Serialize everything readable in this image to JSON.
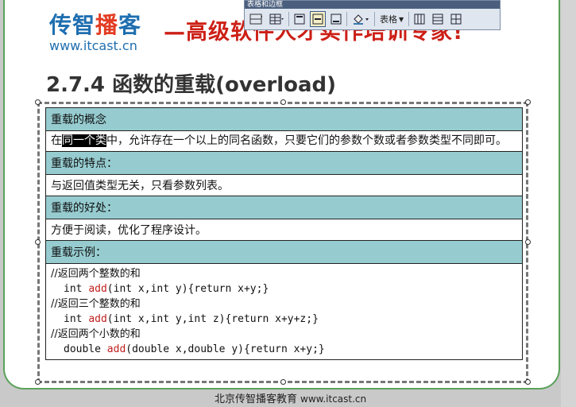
{
  "header": {
    "logo_part1": "传智",
    "logo_part2": "播",
    "logo_part3": "客",
    "logo_url": "www.itcast.cn",
    "slogan": "—高级软件人才实作培训专家!"
  },
  "toolbar": {
    "title": "表格和边框",
    "table_menu": "表格"
  },
  "slide": {
    "title": "2.7.4 函数的重载(overload)",
    "sections": [
      {
        "header": "重载的概念",
        "text_before": "在",
        "selected": "同一个类",
        "text_after": "中，允许存在一个以上的同名函数，只要它们的参数个数或者参数类型不同即可。"
      },
      {
        "header": "重载的特点：",
        "text": "与返回值类型无关，只看参数列表。"
      },
      {
        "header": "重载的好处：",
        "text": "方便于阅读，优化了程序设计。"
      },
      {
        "header": "重载示例："
      }
    ],
    "code": [
      {
        "comment": "//返回两个整数的和"
      },
      {
        "pre": "int ",
        "fn": "add",
        "post": "(int x,int y){return x+y;}"
      },
      {
        "comment": "//返回三个整数的和"
      },
      {
        "pre": "int ",
        "fn": "add",
        "post": "(int x,int y,int z){return x+y+z;}"
      },
      {
        "comment": "//返回两个小数的和"
      },
      {
        "pre": "double ",
        "fn": "add",
        "post": "(double x,double y){return x+y;}"
      }
    ]
  },
  "footer": {
    "org": "北京传智播客教育",
    "url": "www.itcast.cn"
  },
  "colors": {
    "header_fill": "#96ccd0",
    "accent_red": "#cc1f16",
    "logo_blue": "#1f6fb0"
  }
}
